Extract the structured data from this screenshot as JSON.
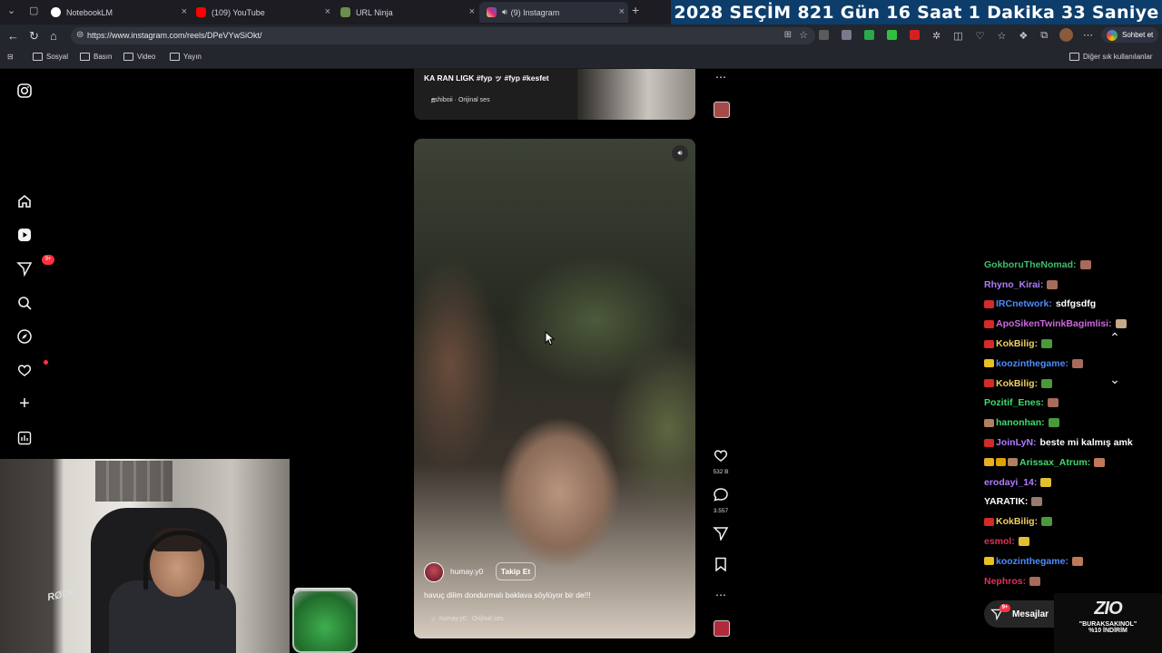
{
  "browser": {
    "tabs": [
      {
        "title": "NotebookLM",
        "active": false
      },
      {
        "title": "(109) YouTube",
        "active": false
      },
      {
        "title": "URL Ninja",
        "active": false
      },
      {
        "title": "(9) Instagram",
        "active": true
      }
    ],
    "url": "https://www.instagram.com/reels/DPeVYwSiOkt/",
    "chat_button": "Sohbet et",
    "bookmarks": [
      "Sosyal",
      "Basın",
      "Video",
      "Yayın"
    ],
    "other_bookmarks": "Diğer sık kullanılanlar"
  },
  "countdown": {
    "year": "2028",
    "label": "SEÇİM",
    "days": "821 Gün",
    "hours": "16 Saat",
    "minutes": "1  Dakika",
    "seconds": "33 Saniye"
  },
  "sidebar": {
    "notifications_badge": "9+"
  },
  "previous_reel": {
    "caption": "KA RAN LIGK #fyp ッ #fyp #kesfet",
    "audio": "eshiboii · Orijinal ses"
  },
  "reel": {
    "username": "humay.y0",
    "follow_label": "Takip Et",
    "caption": "havuç dilim dondurmalı baklava söylüyor bir de!!!",
    "audio": "humay.y0 · Orijinal ses",
    "likes": "532 B",
    "comments": "3.557"
  },
  "chat": {
    "messages": [
      {
        "user": "GokboruTheNomad:",
        "color": "#3fbf6f",
        "badges": [],
        "text": "",
        "emote": "#a86a5a"
      },
      {
        "user": "Rhyno_Kirai:",
        "color": "#b07cff",
        "badges": [],
        "text": "",
        "emote": "#a86a5a"
      },
      {
        "user": "IRCnetwork:",
        "color": "#4c8dff",
        "badges": [
          "#d42a2a"
        ],
        "text": "sdfgsdfg",
        "emote": ""
      },
      {
        "user": "ApoSikenTwinkBagimlisi:",
        "color": "#d066e0",
        "badges": [
          "#d42a2a"
        ],
        "text": "",
        "emote": "#c7a88c"
      },
      {
        "user": "KokBilig:",
        "color": "#f0d060",
        "badges": [
          "#d42a2a"
        ],
        "text": "",
        "emote": "#4a9a3a"
      },
      {
        "user": "koozinthegame:",
        "color": "#4c8dff",
        "badges": [
          "#e8c020"
        ],
        "text": "",
        "emote": "#a86a5a"
      },
      {
        "user": "KokBilig:",
        "color": "#f0d060",
        "badges": [
          "#d42a2a"
        ],
        "text": "",
        "emote": "#4a9a3a"
      },
      {
        "user": "Pozitif_Enes:",
        "color": "#3fdc6f",
        "badges": [],
        "text": "",
        "emote": "#a86a5a"
      },
      {
        "user": "hanonhan:",
        "color": "#3fdc6f",
        "badges": [
          "#b08060"
        ],
        "text": "",
        "emote": "#4a9a3a"
      },
      {
        "user": "JoinLyN:",
        "color": "#b07cff",
        "badges": [
          "#d42a2a"
        ],
        "text": "beste mi kalmış amk",
        "emote": ""
      },
      {
        "user": "Arissax_Atrum:",
        "color": "#3fdc6f",
        "badges": [
          "#e8b020",
          "#e0a000",
          "#b08060"
        ],
        "text": "",
        "emote": "#c0785a"
      },
      {
        "user": "erodayi_14:",
        "color": "#b07cff",
        "badges": [],
        "text": "",
        "emote": "#e0c030"
      },
      {
        "user": "YARATIK:",
        "color": "#ffffff",
        "badges": [],
        "text": "",
        "emote": "#9a7a6a"
      },
      {
        "user": "KokBilig:",
        "color": "#f0d060",
        "badges": [
          "#d42a2a"
        ],
        "text": "",
        "emote": "#4a9a3a"
      },
      {
        "user": "esmol:",
        "color": "#e0305a",
        "badges": [],
        "text": "",
        "emote": "#e0c030"
      },
      {
        "user": "koozinthegame:",
        "color": "#4c8dff",
        "badges": [
          "#e8c020"
        ],
        "text": "",
        "emote": "#c0785a"
      },
      {
        "user": "Nephros:",
        "color": "#e0305a",
        "badges": [],
        "text": "",
        "emote": "#a86a5a"
      }
    ]
  },
  "messages_button": {
    "label": "Mesajlar",
    "badge": "9+"
  },
  "sponsor": {
    "logo": "ZIO",
    "line1": "\"BURAKSAKINOL\"",
    "line2": "%10 İNDİRİM"
  },
  "webcam": {
    "mic_brand": "RØDE"
  }
}
